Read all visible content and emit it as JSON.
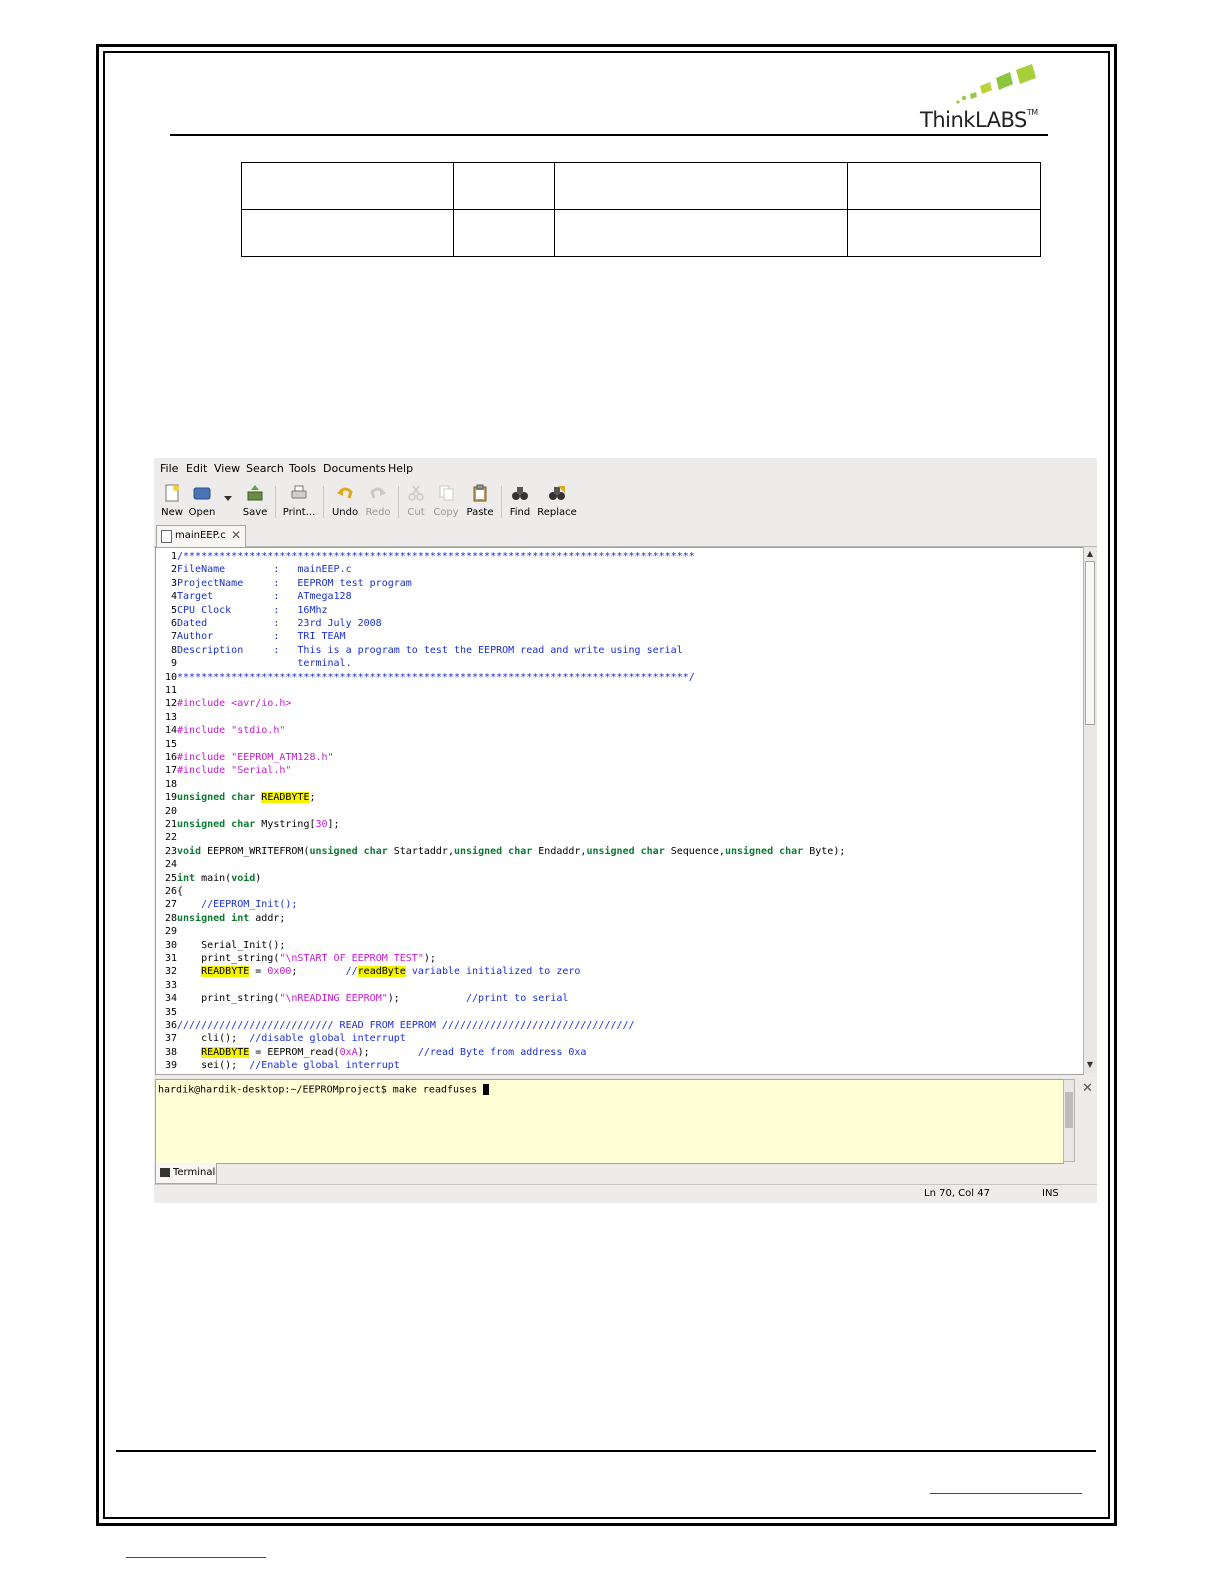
{
  "logo": {
    "brand": "ThinkLABS",
    "tm": "TM"
  },
  "table": {
    "rows": 2,
    "cols": 4
  },
  "editor_app": {
    "menu": [
      "File",
      "Edit",
      "View",
      "Search",
      "Tools",
      "Documents",
      "Help"
    ],
    "toolbar": {
      "new": "New",
      "open": "Open",
      "save": "Save",
      "print": "Print...",
      "undo": "Undo",
      "redo": "Redo",
      "cut": "Cut",
      "copy": "Copy",
      "paste": "Paste",
      "find": "Find",
      "replace": "Replace"
    },
    "tab_label": "mainEEP.c",
    "code_lines": [
      {
        "n": "1",
        "t": [
          [
            "c-com",
            "/*************************************************************************************"
          ]
        ]
      },
      {
        "n": "2",
        "t": [
          [
            "c-com",
            "FileName        :   mainEEP.c"
          ]
        ]
      },
      {
        "n": "3",
        "t": [
          [
            "c-com",
            "ProjectName     :   EEPROM test program"
          ]
        ]
      },
      {
        "n": "4",
        "t": [
          [
            "c-com",
            "Target          :   ATmega128"
          ]
        ]
      },
      {
        "n": "5",
        "t": [
          [
            "c-com",
            "CPU Clock       :   16Mhz"
          ]
        ]
      },
      {
        "n": "6",
        "t": [
          [
            "c-com",
            "Dated           :   23rd July 2008"
          ]
        ]
      },
      {
        "n": "7",
        "t": [
          [
            "c-com",
            "Author          :   TRI TEAM"
          ]
        ]
      },
      {
        "n": "8",
        "t": [
          [
            "c-com",
            "Description     :   This is a program to test the EEPROM read and write using serial"
          ]
        ]
      },
      {
        "n": "9",
        "t": [
          [
            "c-com",
            "                    terminal."
          ]
        ]
      },
      {
        "n": "10",
        "t": [
          [
            "c-com",
            "*************************************************************************************/"
          ]
        ]
      },
      {
        "n": "11",
        "t": []
      },
      {
        "n": "12",
        "t": [
          [
            "c-pre",
            "#include <avr/io.h>"
          ]
        ]
      },
      {
        "n": "13",
        "t": []
      },
      {
        "n": "14",
        "t": [
          [
            "c-pre",
            "#include \"stdio.h\""
          ]
        ]
      },
      {
        "n": "15",
        "t": []
      },
      {
        "n": "16",
        "t": [
          [
            "c-pre",
            "#include \"EEPROM_ATM128.h\""
          ]
        ]
      },
      {
        "n": "17",
        "t": [
          [
            "c-pre",
            "#include \"Serial.h\""
          ]
        ]
      },
      {
        "n": "18",
        "t": []
      },
      {
        "n": "19",
        "t": [
          [
            "c-kw",
            "unsigned char "
          ],
          [
            "c-hl",
            "READBYTE"
          ],
          [
            "code",
            ";"
          ]
        ]
      },
      {
        "n": "20",
        "t": []
      },
      {
        "n": "21",
        "t": [
          [
            "c-kw",
            "unsigned char "
          ],
          [
            "code",
            "Mystring["
          ],
          [
            "c-str",
            "30"
          ],
          [
            "code",
            "];"
          ]
        ]
      },
      {
        "n": "22",
        "t": []
      },
      {
        "n": "23",
        "t": [
          [
            "c-kw",
            "void "
          ],
          [
            "code",
            "EEPROM_WRITEFROM("
          ],
          [
            "c-kw",
            "unsigned char "
          ],
          [
            "code",
            "Startaddr,"
          ],
          [
            "c-kw",
            "unsigned char "
          ],
          [
            "code",
            "Endaddr,"
          ],
          [
            "c-kw",
            "unsigned char "
          ],
          [
            "code",
            "Sequence,"
          ],
          [
            "c-kw",
            "unsigned char "
          ],
          [
            "code",
            "Byte);"
          ]
        ]
      },
      {
        "n": "24",
        "t": []
      },
      {
        "n": "25",
        "t": [
          [
            "c-kw",
            "int "
          ],
          [
            "code",
            "main("
          ],
          [
            "c-kw",
            "void"
          ],
          [
            "code",
            ")"
          ]
        ]
      },
      {
        "n": "26",
        "t": [
          [
            "code",
            "{"
          ]
        ]
      },
      {
        "n": "27",
        "t": [
          [
            "c-com",
            "    //EEPROM_Init();"
          ]
        ]
      },
      {
        "n": "28",
        "t": [
          [
            "c-kw",
            "unsigned int "
          ],
          [
            "code",
            "addr;"
          ]
        ]
      },
      {
        "n": "29",
        "t": []
      },
      {
        "n": "30",
        "t": [
          [
            "code",
            "    Serial_Init();"
          ]
        ]
      },
      {
        "n": "31",
        "t": [
          [
            "code",
            "    print_string("
          ],
          [
            "c-str",
            "\"\\nSTART OF EEPROM TEST\""
          ],
          [
            "code",
            ");"
          ]
        ]
      },
      {
        "n": "32",
        "t": [
          [
            "code",
            "    "
          ],
          [
            "c-hl",
            "READBYTE"
          ],
          [
            "code",
            " = "
          ],
          [
            "c-str",
            "0x00"
          ],
          [
            "code",
            ";        "
          ],
          [
            "c-com",
            "//"
          ],
          [
            "c-hl",
            "readByte"
          ],
          [
            "c-com",
            " variable initialized to zero"
          ]
        ]
      },
      {
        "n": "33",
        "t": []
      },
      {
        "n": "34",
        "t": [
          [
            "code",
            "    print_string("
          ],
          [
            "c-str",
            "\"\\nREADING EEPROM\""
          ],
          [
            "code",
            ");           "
          ],
          [
            "c-com",
            "//print to serial"
          ]
        ]
      },
      {
        "n": "35",
        "t": []
      },
      {
        "n": "36",
        "t": [
          [
            "c-com",
            "////////////////////////// READ FROM EEPROM ////////////////////////////////"
          ]
        ]
      },
      {
        "n": "37",
        "t": [
          [
            "code",
            "    cli();  "
          ],
          [
            "c-com",
            "//disable global interrupt"
          ]
        ]
      },
      {
        "n": "38",
        "t": [
          [
            "code",
            "    "
          ],
          [
            "c-hl",
            "READBYTE"
          ],
          [
            "code",
            " = EEPROM_read("
          ],
          [
            "c-str",
            "0xA"
          ],
          [
            "code",
            ");        "
          ],
          [
            "c-com",
            "//read Byte from address 0xa"
          ]
        ]
      },
      {
        "n": "39",
        "t": [
          [
            "code",
            "    sei();  "
          ],
          [
            "c-com",
            "//Enable global interrupt"
          ]
        ]
      }
    ],
    "terminal_prompt": "hardik@hardik-desktop:~/EEPROMproject$ make readfuses ",
    "terminal_tab": "Terminal",
    "status_position": "Ln 70, Col 47",
    "status_mode": "INS"
  }
}
